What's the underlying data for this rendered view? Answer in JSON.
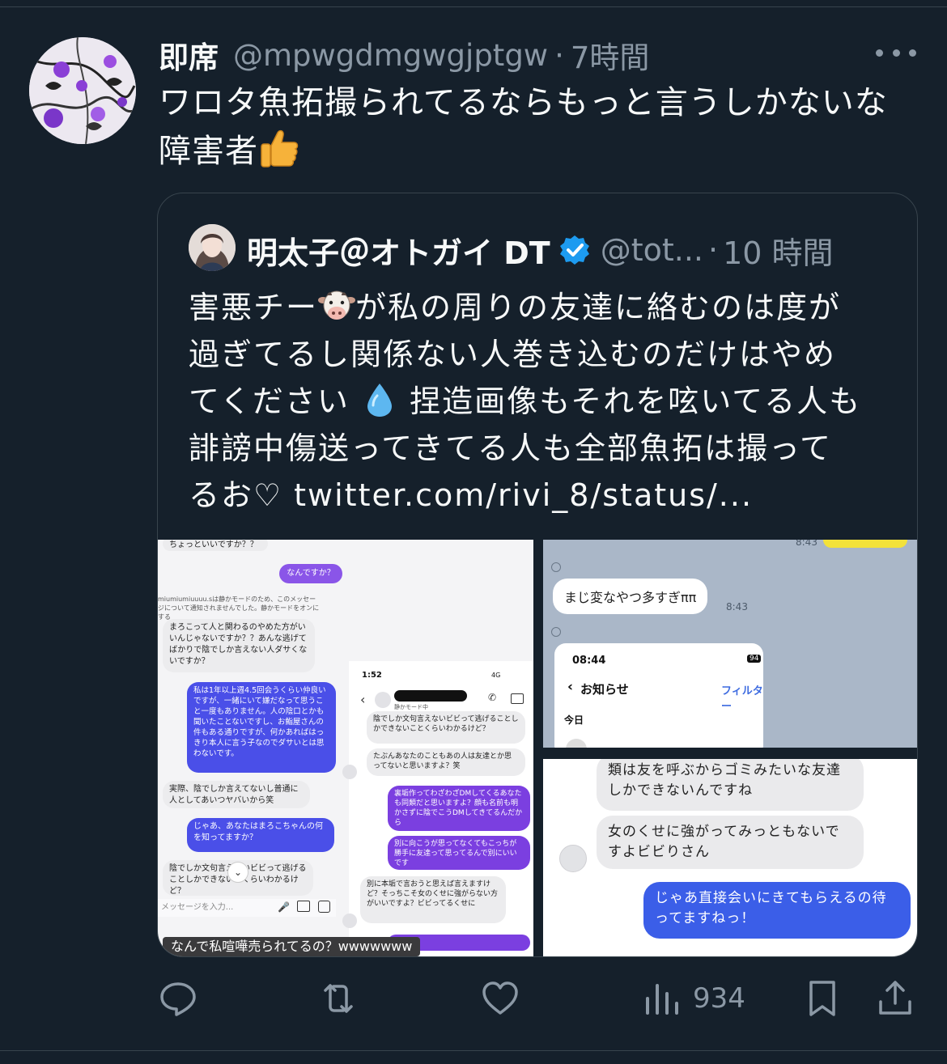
{
  "tweet": {
    "display_name": "即席",
    "handle": "@mpwgdmgwgjptgw",
    "separator": "·",
    "time": "7時間",
    "text_line1": "ワロタ魚拓撮られてるならもっと言うしかないな",
    "text_line2": "障害者"
  },
  "quote": {
    "display_name": "明太子＠オトガイ DT",
    "handle": "@tot...",
    "separator": "·",
    "time": "10 時間",
    "line1_a": "害悪チー",
    "line1_b": "が私の周りの友達に絡むのは度が",
    "line2": "過ぎてるし関係ない人巻き込むのだけはやめ",
    "line3_a": "てください",
    "line3_b": "捏造画像もそれを呟いてる人も",
    "line4": "誹謗中傷送ってきてる人も全部魚拓は撮って",
    "line5": "るお♡ twitter.com/rivi_8/status/..."
  },
  "media": {
    "left": {
      "top_cut": "ちょっといいですか？？",
      "msg_nandesuka": "なんですか？",
      "notice": "miumiumiuuuu.sは静かモードのため、このメッセージについて通知されませんでした。静かモードをオンにする",
      "msg1": "まろこって人と関わるのやめた方がいいんじゃないですか？？あんな逃げてばかりで陰でしか言えない人ダサくないですか？",
      "msg2": "私は1年以上週4.5回会うくらい仲良いですが、一緒にいて嫌だなって思うこと一度もありません。人の陰口とかも聞いたことないですし、お鮨屋さんの件もある通りですが、何かあればはっきり本人に言う子なのでダサいとは思わないです。",
      "msg3": "実際、陰でしか言えてないし普通に人としてあいつヤバいから笑",
      "msg4": "じゃあ、あなたはまろこちゃんの何を知ってますか？",
      "msg5": "陰でしか文句言えないビビって逃げることしかできないとくらいわかるけど？",
      "input_placeholder": "メッセージを入力...",
      "phone_time": "1:52",
      "phone_signal": "4G",
      "phone_quiet": "静かモード中",
      "p_msg1": "陰でしか文句言えないビビって逃げることしかできないことくらいわかるけど？",
      "p_msg2": "たぶんあなたのこともあの人は友達とか思ってないと思いますよ？笑",
      "p_msg3": "裏垢作ってわざわざDMしてくるあなたも同類だと思いますよ？顔も名前も明かさずに陰でこうDMしてきてるんだから",
      "p_msg4": "別に向こうが思ってなくてもこっちが勝手に友達って思ってるんで別にいいです",
      "p_msg5": "別に本垢で言おうと思えば言えますけど？そっちこそ女のくせに強がらない方がいいですよ？ビビってるくせに",
      "caption": "なんで私喧嘩売られてるの？wwwwwww"
    },
    "top_right": {
      "time_top": "8:43",
      "bubble": "まじ変なやつ多すぎ",
      "bubble_suffix": "ππ",
      "bubble_time": "8:43",
      "card_time": "08:44",
      "card_battery": "94",
      "card_title": "お知らせ",
      "card_filter": "フィルター",
      "card_today": "今日"
    },
    "bottom_right": {
      "msg1": "類は友を呼ぶからゴミみたいな友達しかできないんですね",
      "msg2": "女のくせに強がってみっともないですよビビりさん",
      "msg3": "じゃあ直接会いにきてもらえるの待ってますねっ！"
    }
  },
  "actions": {
    "views": "934"
  },
  "icons": [
    "reply-icon",
    "retweet-icon",
    "like-icon",
    "views-icon",
    "bookmark-icon",
    "share-icon",
    "more-icon",
    "verified-icon",
    "thumbs-up-emoji",
    "cow-emoji",
    "droplet-emoji"
  ],
  "colors": {
    "background": "#15202b",
    "text": "#f7f9f9",
    "muted": "#8b98a5",
    "verified": "#1d9bf0",
    "border": "#38444d"
  }
}
